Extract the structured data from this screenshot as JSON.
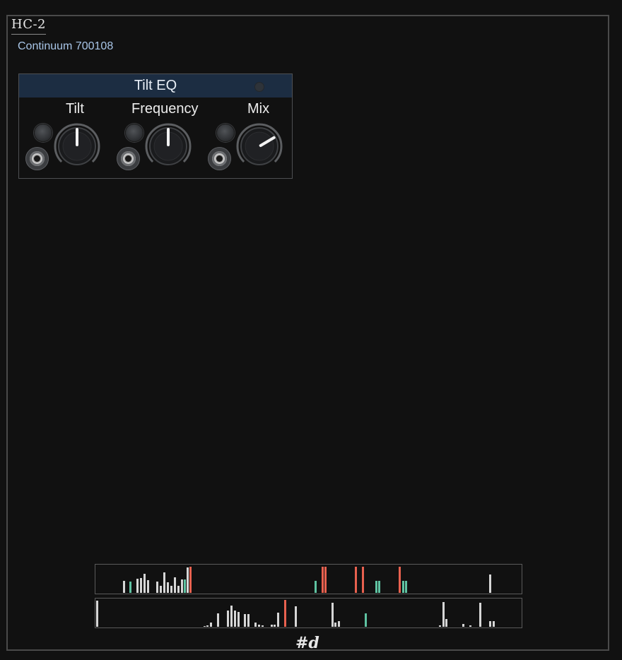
{
  "app": {
    "title": "HC-2",
    "subtitle": "Continuum 700108"
  },
  "module": {
    "title": "Tilt EQ",
    "params": [
      {
        "label": "Tilt",
        "value": 0.5
      },
      {
        "label": "Frequency",
        "value": 0.5
      },
      {
        "label": "Mix",
        "value": 0.72
      }
    ]
  },
  "colors": {
    "header": "#1c2d42",
    "subtitle": "#a9c6e8",
    "bar_default": "#d6d6d6",
    "bar_accent_red": "#e8614f",
    "bar_accent_green": "#5fc3a2"
  },
  "footer": {
    "logo": "#d"
  }
}
